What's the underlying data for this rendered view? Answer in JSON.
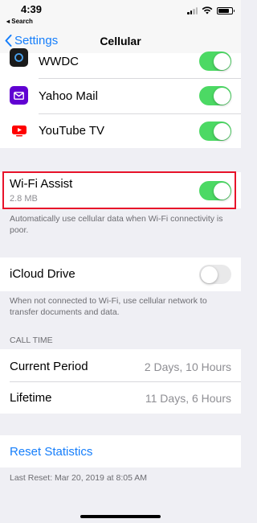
{
  "status_bar": {
    "time": "4:39",
    "back_app": "◂ Search"
  },
  "nav": {
    "back_label": "Settings",
    "title": "Cellular"
  },
  "apps": [
    {
      "name": "WWDC",
      "enabled": true,
      "icon": "wwdc-icon",
      "color": "#1a1a1a"
    },
    {
      "name": "Yahoo Mail",
      "enabled": true,
      "icon": "yahoo-mail-icon",
      "color": "#6001d2"
    },
    {
      "name": "YouTube TV",
      "enabled": true,
      "icon": "youtube-tv-icon",
      "color": "#ff0000"
    }
  ],
  "wifi_assist": {
    "label": "Wi-Fi Assist",
    "usage": "2.8 MB",
    "enabled": true,
    "description": "Automatically use cellular data when Wi-Fi connectivity is poor."
  },
  "icloud_drive": {
    "label": "iCloud Drive",
    "enabled": false,
    "description": "When not connected to Wi-Fi, use cellular network to transfer documents and data."
  },
  "call_time": {
    "header": "CALL TIME",
    "current_period_label": "Current Period",
    "current_period_value": "2 Days, 10 Hours",
    "lifetime_label": "Lifetime",
    "lifetime_value": "11 Days, 6 Hours"
  },
  "reset": {
    "label": "Reset Statistics",
    "last_reset": "Last Reset: Mar 20, 2019 at 8:05 AM"
  },
  "colors": {
    "accent": "#157efb",
    "toggle_on": "#4cd964",
    "highlight": "#e8132a"
  }
}
